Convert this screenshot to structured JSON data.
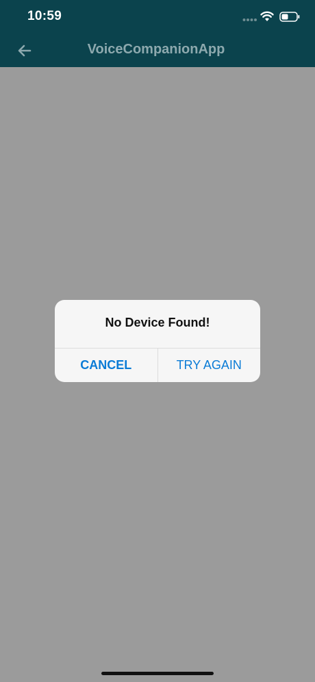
{
  "status_bar": {
    "time": "10:59",
    "icons": [
      "signal-dots-icon",
      "wifi-icon",
      "battery-icon"
    ]
  },
  "nav": {
    "title": "VoiceCompanionApp",
    "back_icon": "arrow-left-icon"
  },
  "dialog": {
    "title": "No Device Found!",
    "cancel_label": "CANCEL",
    "retry_label": "TRY AGAIN"
  },
  "colors": {
    "header_bg": "#0b434d",
    "overlay_bg": "#9b9b9b",
    "dialog_bg": "#f6f6f6",
    "button_text": "#0a7bd6"
  }
}
